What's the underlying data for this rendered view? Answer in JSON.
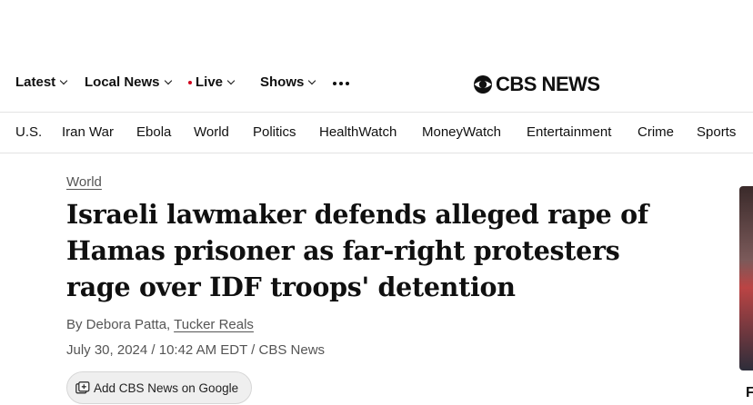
{
  "topnav": {
    "items": [
      {
        "label": "Latest"
      },
      {
        "label": "Local News"
      },
      {
        "label": "Live"
      },
      {
        "label": "Shows"
      }
    ],
    "more_icon": "more-dots-icon"
  },
  "brand": {
    "logo_text": "CBS NEWS",
    "logo_icon": "cbs-eye-icon"
  },
  "sections": [
    "U.S.",
    "Iran War",
    "Ebola",
    "World",
    "Politics",
    "HealthWatch",
    "MoneyWatch",
    "Entertainment",
    "Crime",
    "Sports"
  ],
  "article": {
    "kicker": "World",
    "headline": "Israeli lawmaker defends alleged rape of Hamas prisoner as far-right protesters rage over IDF troops' detention",
    "byline_prefix": "By Debora Patta, ",
    "byline_link": "Tucker Reals",
    "dateline": "July 30, 2024 / 10:42 AM EDT / CBS News",
    "google_button_label": "Add CBS News on Google"
  },
  "sidebar": {
    "partial_letter": "F"
  },
  "colors": {
    "live_dot": "#d0021b",
    "text": "#101010",
    "muted": "#555555",
    "divider": "#e3e3e3"
  }
}
